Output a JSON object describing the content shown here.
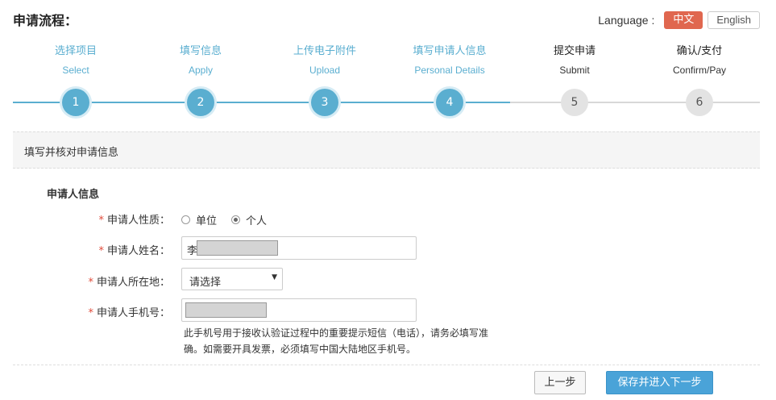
{
  "page": {
    "title": "申请流程："
  },
  "language": {
    "label": "Language :",
    "options": [
      "中文",
      "English"
    ],
    "active": "中文"
  },
  "steps": [
    {
      "cn": "选择项目",
      "en": "Select",
      "num": "1",
      "status": "done"
    },
    {
      "cn": "填写信息",
      "en": "Apply",
      "num": "2",
      "status": "done"
    },
    {
      "cn": "上传电子附件",
      "en": "Upload",
      "num": "3",
      "status": "done"
    },
    {
      "cn": "填写申请人信息",
      "en": "Personal Details",
      "num": "4",
      "status": "done"
    },
    {
      "cn": "提交申请",
      "en": "Submit",
      "num": "5",
      "status": "todo"
    },
    {
      "cn": "确认/支付",
      "en": "Confirm/Pay",
      "num": "6",
      "status": "todo"
    }
  ],
  "section": {
    "title": "填写并核对申请信息"
  },
  "form": {
    "group_title": "申请人信息",
    "required_mark": "*",
    "nature": {
      "label": "申请人性质：",
      "options": [
        "单位",
        "个人"
      ],
      "selected": "个人"
    },
    "name": {
      "label": "申请人姓名：",
      "value": "李"
    },
    "location": {
      "label": "申请人所在地：",
      "value": "请选择"
    },
    "phone": {
      "label": "申请人手机号：",
      "value": ""
    },
    "hint": "此手机号用于接收认验证过程中的重要提示短信（电话），请务必填写准确。如需要开具发票，必须填写中国大陆地区手机号。"
  },
  "buttons": {
    "prev": "上一步",
    "next": "保存并进入下一步"
  },
  "colors": {
    "accent": "#5aaed0",
    "language_active": "#e0674f",
    "primary_button": "#4aa3d8",
    "required": "#e04b3b"
  }
}
